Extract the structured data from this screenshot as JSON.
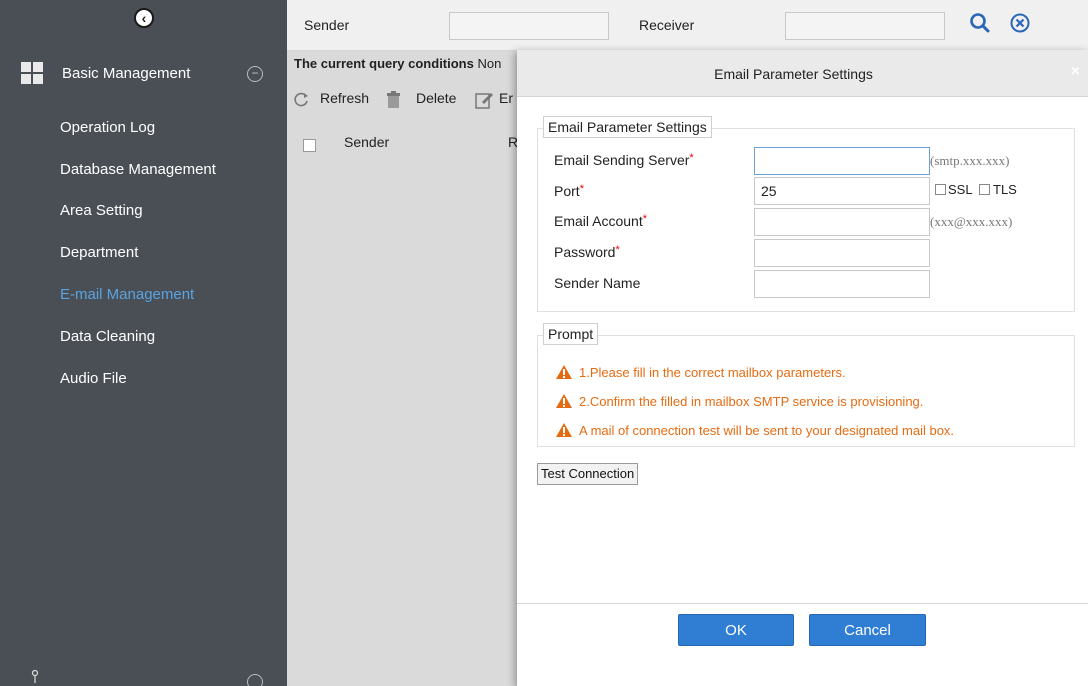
{
  "sidebar": {
    "collapse_icon": "chevron-left-circle-icon",
    "module_title": "Basic Management",
    "items": [
      {
        "label": "Operation Log",
        "active": false
      },
      {
        "label": "Database Management",
        "active": false
      },
      {
        "label": "Area Setting",
        "active": false
      },
      {
        "label": "Department",
        "active": false
      },
      {
        "label": "E-mail Management",
        "active": true
      },
      {
        "label": "Data Cleaning",
        "active": false
      },
      {
        "label": "Audio File",
        "active": false
      }
    ]
  },
  "search": {
    "sender_label": "Sender",
    "sender_value": "",
    "receiver_label": "Receiver",
    "receiver_value": ""
  },
  "query": {
    "label": "The current query conditions",
    "value": "Non"
  },
  "toolbar": {
    "refresh_label": "Refresh",
    "delete_label": "Delete",
    "email_label": "Er"
  },
  "table": {
    "columns": [
      "Sender",
      "R"
    ]
  },
  "dialog": {
    "title": "Email Parameter Settings",
    "close_glyph": "×",
    "section_title": "Email Parameter Settings",
    "fields": {
      "server_label": "Email Sending Server",
      "server_value": "",
      "server_hint": "(smtp.xxx.xxx)",
      "port_label": "Port",
      "port_value": "25",
      "ssl_label": "SSL",
      "tls_label": "TLS",
      "account_label": "Email Account",
      "account_value": "",
      "account_hint": "(xxx@xxx.xxx)",
      "password_label": "Password",
      "password_value": "",
      "sender_name_label": "Sender Name",
      "sender_name_value": ""
    },
    "required_mark": "*",
    "prompt_title": "Prompt",
    "prompts": [
      "1.Please fill in the correct mailbox parameters.",
      "2.Confirm the filled in mailbox SMTP service is provisioning.",
      "A mail of connection test will be sent to your designated mail box."
    ],
    "test_button": "Test Connection",
    "ok_button": "OK",
    "cancel_button": "Cancel"
  },
  "colors": {
    "sidebar_bg": "#4a4f55",
    "active_item": "#5aa3e0",
    "primary_button": "#2f7ed4",
    "warning": "#e56b12",
    "required": "#e00000"
  }
}
